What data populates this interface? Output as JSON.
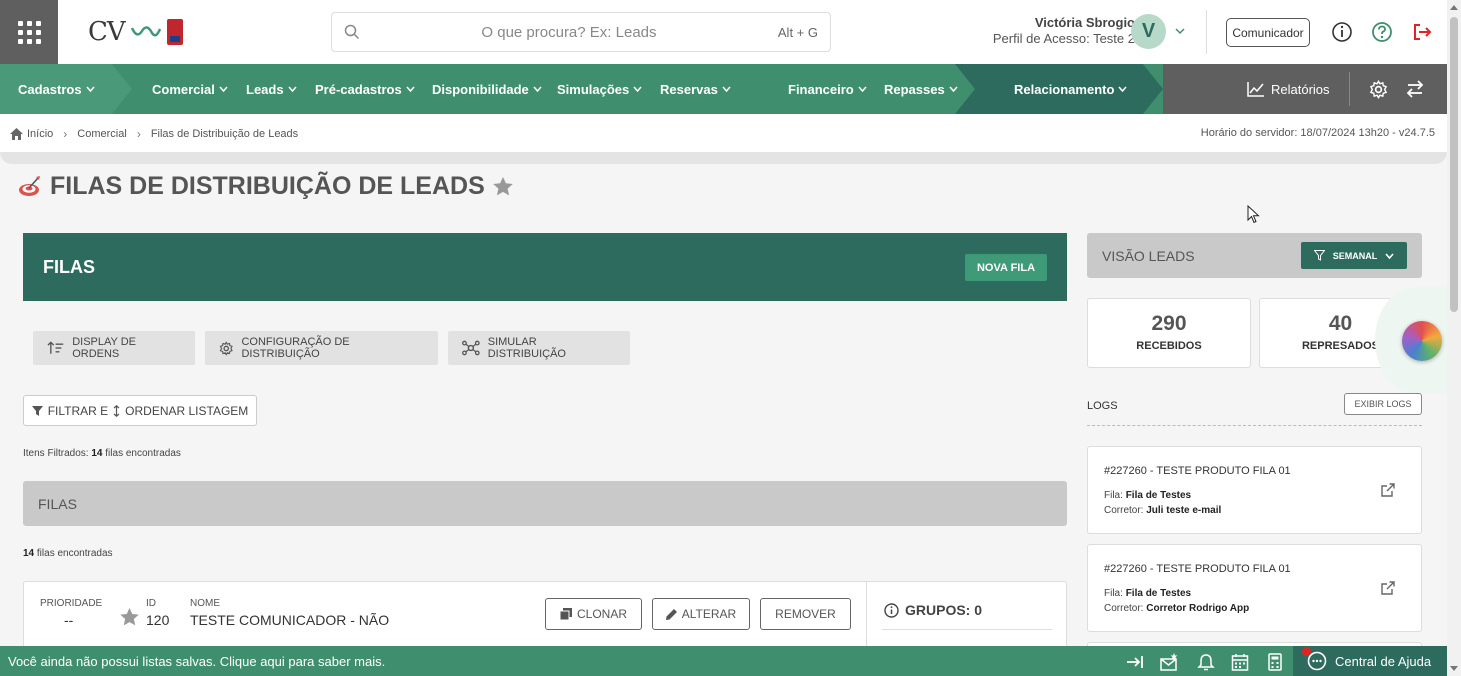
{
  "header": {
    "logo_text": "CV",
    "search_placeholder": "O que procura? Ex: Leads",
    "search_shortcut": "Alt + G",
    "user_name": "Victória Sbrogio",
    "user_profile": "Perfil de Acesso: Teste 2",
    "avatar_letter": "V",
    "comunicador_label": "Comunicador"
  },
  "nav": {
    "items": [
      "Cadastros",
      "Comercial",
      "Leads",
      "Pré-cadastros",
      "Disponibilidade",
      "Simulações",
      "Reservas",
      "Financeiro",
      "Repasses",
      "Relacionamento"
    ],
    "reports_label": "Relatórios"
  },
  "breadcrumb": {
    "items": [
      "Início",
      "Comercial",
      "Filas de Distribuição de Leads"
    ],
    "server_time": "Horário do servidor: 18/07/2024 13h20 - v24.7.5"
  },
  "page": {
    "title": "FILAS DE DISTRIBUIÇÃO DE LEADS",
    "banner_title": "FILAS",
    "new_queue_label": "NOVA FILA",
    "tools": [
      "DISPLAY DE ORDENS",
      "CONFIGURAÇÃO DE DISTRIBUIÇÃO",
      "SIMULAR DISTRIBUIÇÃO"
    ],
    "filter_label": "FILTRAR E",
    "sort_label": "ORDENAR LISTAGEM",
    "filtered_prefix": "Itens Filtrados:",
    "filtered_count": "14",
    "filtered_suffix": "filas encontradas",
    "section_title": "FILAS",
    "found_count": "14",
    "found_suffix": "filas encontradas"
  },
  "queue": {
    "priority_label": "PRIORIDADE",
    "priority_value": "--",
    "id_label": "ID",
    "id_value": "120",
    "name_label": "NOME",
    "name_value": "TESTE COMUNICADOR - NÃO",
    "clone_label": "CLONAR",
    "edit_label": "ALTERAR",
    "remove_label": "REMOVER",
    "groups_label": "GRUPOS: 0"
  },
  "visao": {
    "title": "VISÃO LEADS",
    "period": "SEMANAL",
    "received_value": "290",
    "received_label": "RECEBIDOS",
    "repressed_value": "40",
    "repressed_label": "REPRESADOS"
  },
  "logs": {
    "title": "LOGS",
    "show_label": "EXIBIR LOGS",
    "fila_label": "Fila:",
    "corretor_label": "Corretor:",
    "entries": [
      {
        "title": "#227260 - TESTE PRODUTO FILA 01",
        "fila": "Fila de Testes",
        "corretor": "Juli teste e-mail"
      },
      {
        "title": "#227260 - TESTE PRODUTO FILA 01",
        "fila": "Fila de Testes",
        "corretor": "Corretor Rodrigo App"
      }
    ]
  },
  "footer": {
    "message": "Você ainda não possui listas salvas. Clique aqui para saber mais.",
    "help_label": "Central de Ajuda"
  },
  "colors": {
    "nav_green": "#3f8f6e",
    "dark_green": "#2e6b5f",
    "nav_gray": "#5f5f5f"
  }
}
